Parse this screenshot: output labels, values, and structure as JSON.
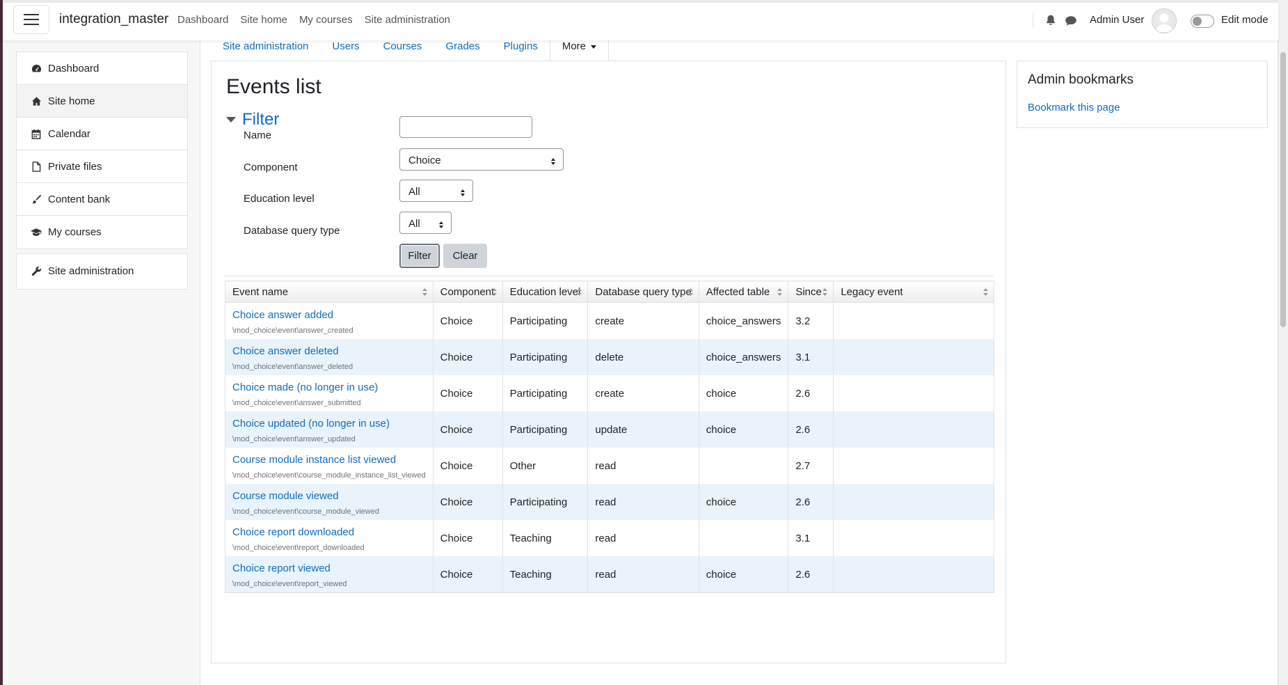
{
  "brand": "integration_master",
  "topnav": [
    "Dashboard",
    "Site home",
    "My courses",
    "Site administration"
  ],
  "user": {
    "name": "Admin User",
    "edit_mode_label": "Edit mode",
    "edit_mode_on": false
  },
  "sidebar": {
    "items": [
      {
        "label": "Dashboard",
        "icon": "dashboard-icon"
      },
      {
        "label": "Site home",
        "icon": "home-icon"
      },
      {
        "label": "Calendar",
        "icon": "calendar-icon"
      },
      {
        "label": "Private files",
        "icon": "file-icon"
      },
      {
        "label": "Content bank",
        "icon": "paintbrush-icon"
      },
      {
        "label": "My courses",
        "icon": "graduation-cap-icon"
      }
    ],
    "admin_item": {
      "label": "Site administration",
      "icon": "wrench-icon"
    }
  },
  "tabs": [
    "Site administration",
    "Users",
    "Courses",
    "Grades",
    "Plugins",
    "More"
  ],
  "page_title": "Events list",
  "filter": {
    "title": "Filter",
    "name_label": "Name",
    "name_value": "",
    "component_label": "Component",
    "component_value": "Choice",
    "edu_label": "Education level",
    "edu_value": "All",
    "dbq_label": "Database query type",
    "dbq_value": "All",
    "filter_button": "Filter",
    "clear_button": "Clear"
  },
  "table": {
    "headers": [
      "Event name",
      "Component",
      "Education level",
      "Database query type",
      "Affected table",
      "Since",
      "Legacy event"
    ],
    "rows": [
      {
        "name": "Choice answer added",
        "cls": "\\mod_choice\\event\\answer_created",
        "component": "Choice",
        "edu": "Participating",
        "crud": "create",
        "table": "choice_answers",
        "since": "3.2",
        "legacy": ""
      },
      {
        "name": "Choice answer deleted",
        "cls": "\\mod_choice\\event\\answer_deleted",
        "component": "Choice",
        "edu": "Participating",
        "crud": "delete",
        "table": "choice_answers",
        "since": "3.1",
        "legacy": ""
      },
      {
        "name": "Choice made (no longer in use)",
        "cls": "\\mod_choice\\event\\answer_submitted",
        "component": "Choice",
        "edu": "Participating",
        "crud": "create",
        "table": "choice",
        "since": "2.6",
        "legacy": ""
      },
      {
        "name": "Choice updated (no longer in use)",
        "cls": "\\mod_choice\\event\\answer_updated",
        "component": "Choice",
        "edu": "Participating",
        "crud": "update",
        "table": "choice",
        "since": "2.6",
        "legacy": ""
      },
      {
        "name": "Course module instance list viewed",
        "cls": "\\mod_choice\\event\\course_module_instance_list_viewed",
        "component": "Choice",
        "edu": "Other",
        "crud": "read",
        "table": "",
        "since": "2.7",
        "legacy": ""
      },
      {
        "name": "Course module viewed",
        "cls": "\\mod_choice\\event\\course_module_viewed",
        "component": "Choice",
        "edu": "Participating",
        "crud": "read",
        "table": "choice",
        "since": "2.6",
        "legacy": ""
      },
      {
        "name": "Choice report downloaded",
        "cls": "\\mod_choice\\event\\report_downloaded",
        "component": "Choice",
        "edu": "Teaching",
        "crud": "read",
        "table": "",
        "since": "3.1",
        "legacy": ""
      },
      {
        "name": "Choice report viewed",
        "cls": "\\mod_choice\\event\\report_viewed",
        "component": "Choice",
        "edu": "Teaching",
        "crud": "read",
        "table": "choice",
        "since": "2.6",
        "legacy": ""
      }
    ]
  },
  "block": {
    "title": "Admin bookmarks",
    "link": "Bookmark this page"
  },
  "colors": {
    "link": "#0f6cbf",
    "row_alt": "#e9f3fb",
    "border": "#dee2e6"
  }
}
